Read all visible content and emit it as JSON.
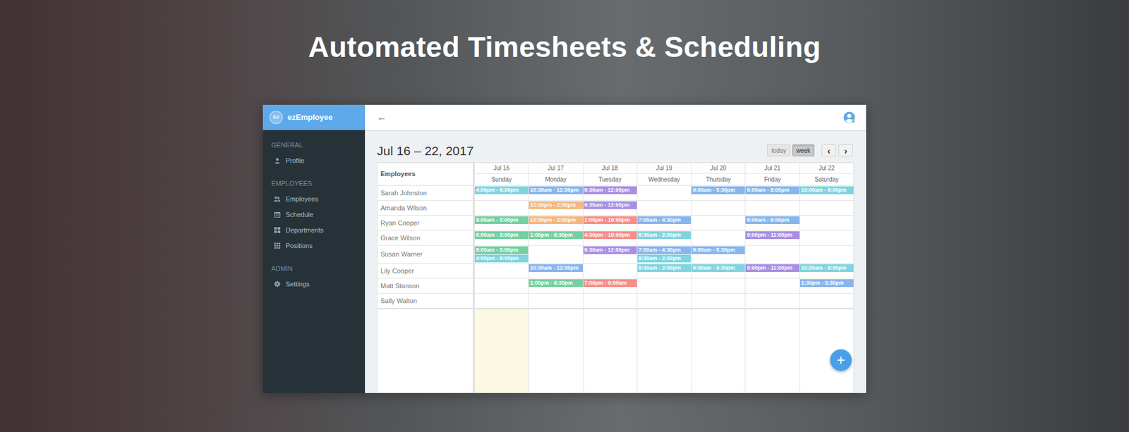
{
  "page": {
    "heading": "Automated Timesheets & Scheduling"
  },
  "app": {
    "logo": "EZ",
    "name": "ezEmployee",
    "back": "←",
    "add": "+"
  },
  "sidebar": {
    "sections": [
      {
        "label": "GENERAL",
        "items": [
          {
            "label": "Profile"
          }
        ]
      },
      {
        "label": "EMPLOYEES",
        "items": [
          {
            "label": "Employees"
          },
          {
            "label": "Schedule"
          },
          {
            "label": "Departments"
          },
          {
            "label": "Positions"
          }
        ]
      },
      {
        "label": "ADMIN",
        "items": [
          {
            "label": "Settings"
          }
        ]
      }
    ]
  },
  "calendar": {
    "title": "Jul 16 – 22, 2017",
    "view_buttons": [
      {
        "label": "today",
        "selected": false
      },
      {
        "label": "week",
        "selected": true
      }
    ],
    "nav": [
      "‹",
      "›"
    ],
    "employees_header": "Employees",
    "days": [
      {
        "date": "Jul 16",
        "weekday": "Sunday",
        "today": true
      },
      {
        "date": "Jul 17",
        "weekday": "Monday",
        "today": false
      },
      {
        "date": "Jul 18",
        "weekday": "Tuesday",
        "today": false
      },
      {
        "date": "Jul 19",
        "weekday": "Wednesday",
        "today": false
      },
      {
        "date": "Jul 20",
        "weekday": "Thursday",
        "today": false
      },
      {
        "date": "Jul 21",
        "weekday": "Friday",
        "today": false
      },
      {
        "date": "Jul 22",
        "weekday": "Saturday",
        "today": false
      }
    ],
    "rows": [
      {
        "name": "Sarah Johnston",
        "days": [
          [
            {
              "time": "4:00pm - 6:00pm",
              "color": "#80d4df"
            }
          ],
          [
            {
              "time": "10:30am - 12:30pm",
              "color": "#87b5ec"
            }
          ],
          [
            {
              "time": "9:30am - 12:00pm",
              "color": "#a98ee3"
            }
          ],
          [],
          [
            {
              "time": "9:00am - 5:30pm",
              "color": "#87b5ec"
            }
          ],
          [
            {
              "time": "9:00am - 8:00pm",
              "color": "#87b5ec"
            }
          ],
          [
            {
              "time": "10:00am - 9:00pm",
              "color": "#80d4df"
            }
          ]
        ]
      },
      {
        "name": "Amanda Wilson",
        "days": [
          [],
          [
            {
              "time": "12:00pm - 2:00pm",
              "color": "#f4b77f"
            }
          ],
          [
            {
              "time": "9:30am - 12:00pm",
              "color": "#a98ee3"
            }
          ],
          [],
          [],
          [],
          []
        ]
      },
      {
        "name": "Ryan Cooper",
        "days": [
          [
            {
              "time": "8:00am - 3:00pm",
              "color": "#74d0a0"
            }
          ],
          [
            {
              "time": "12:00pm - 2:00pm",
              "color": "#f4b77f"
            }
          ],
          [
            {
              "time": "1:00pm - 10:00pm",
              "color": "#f48f89"
            }
          ],
          [
            {
              "time": "7:00am - 4:30pm",
              "color": "#87b5ec"
            }
          ],
          [],
          [
            {
              "time": "9:00am - 8:00pm",
              "color": "#87b5ec"
            }
          ],
          []
        ]
      },
      {
        "name": "Grace Wilson",
        "days": [
          [
            {
              "time": "8:00am - 3:00pm",
              "color": "#74d0a0"
            }
          ],
          [
            {
              "time": "1:00pm - 6:30pm",
              "color": "#74d0a0"
            }
          ],
          [
            {
              "time": "4:30pm - 10:00pm",
              "color": "#f48f89"
            }
          ],
          [
            {
              "time": "8:30am - 2:00pm",
              "color": "#80d4df"
            }
          ],
          [],
          [
            {
              "time": "9:00pm - 11:00pm",
              "color": "#a98ee3"
            }
          ],
          []
        ]
      },
      {
        "name": "Susan Warner",
        "days": [
          [
            {
              "time": "8:00am - 3:00pm",
              "color": "#74d0a0"
            },
            {
              "time": "4:00pm - 6:00pm",
              "color": "#80d4df"
            }
          ],
          [],
          [
            {
              "time": "9:30am - 12:00pm",
              "color": "#a98ee3"
            }
          ],
          [
            {
              "time": "7:00am - 4:30pm",
              "color": "#87b5ec"
            },
            {
              "time": "8:30am - 2:00pm",
              "color": "#80d4df"
            }
          ],
          [
            {
              "time": "9:00am - 5:30pm",
              "color": "#87b5ec"
            }
          ],
          [],
          []
        ]
      },
      {
        "name": "Lily Cooper",
        "days": [
          [],
          [
            {
              "time": "10:30am - 12:30pm",
              "color": "#87b5ec"
            }
          ],
          [],
          [
            {
              "time": "8:30am - 2:00pm",
              "color": "#80d4df"
            }
          ],
          [
            {
              "time": "9:00am - 5:30pm",
              "color": "#80d4df"
            }
          ],
          [
            {
              "time": "9:00pm - 11:00pm",
              "color": "#a98ee3"
            }
          ],
          [
            {
              "time": "10:00am - 9:00pm",
              "color": "#80d4df"
            }
          ]
        ]
      },
      {
        "name": "Matt Stanson",
        "days": [
          [],
          [
            {
              "time": "1:00pm - 6:30pm",
              "color": "#74d0a0"
            }
          ],
          [
            {
              "time": "7:00pm - 9:00am",
              "color": "#f48f89"
            }
          ],
          [],
          [],
          [],
          [
            {
              "time": "1:30pm - 5:30pm",
              "color": "#87b5ec"
            }
          ]
        ]
      },
      {
        "name": "Sally Walton",
        "days": [
          [],
          [],
          [],
          [],
          [],
          [],
          []
        ]
      }
    ]
  }
}
